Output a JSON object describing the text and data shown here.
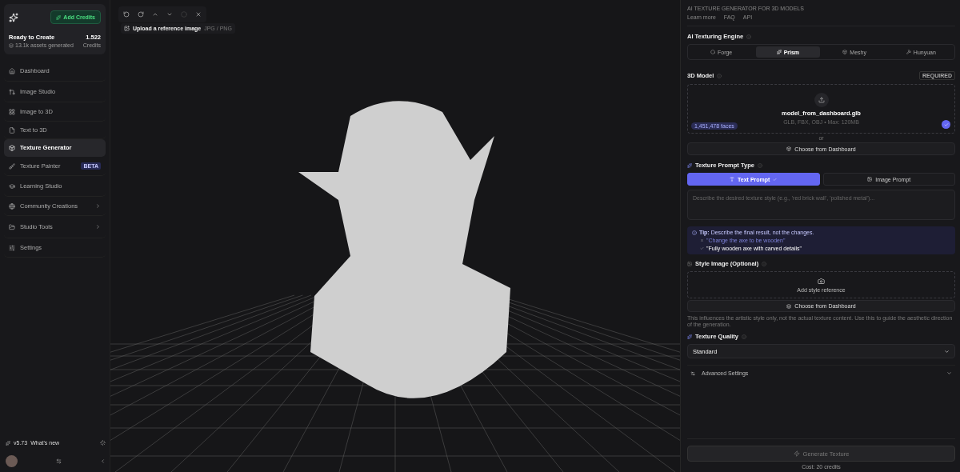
{
  "account": {
    "add_credits": "Add Credits",
    "status": "Ready to Create",
    "assets": "13.1k assets generated",
    "credits_value": "1.522",
    "credits_label": "Credits"
  },
  "sidebar": {
    "items": [
      {
        "label": "Dashboard",
        "selected": false,
        "submenu": false
      },
      {
        "label": "Image Studio",
        "selected": false,
        "submenu": false
      },
      {
        "label": "Image to 3D",
        "selected": false,
        "submenu": false
      },
      {
        "label": "Text to 3D",
        "selected": false,
        "submenu": false
      },
      {
        "label": "Texture Generator",
        "selected": true,
        "submenu": false
      },
      {
        "label": "Texture Painter",
        "selected": false,
        "submenu": false,
        "badge": "BETA"
      },
      {
        "label": "Learning Studio",
        "selected": false,
        "submenu": false
      },
      {
        "label": "Community Creations",
        "selected": false,
        "submenu": true
      },
      {
        "label": "Studio Tools",
        "selected": false,
        "submenu": true
      },
      {
        "label": "Settings",
        "selected": false,
        "submenu": false
      }
    ],
    "version": "v5.73",
    "whats_new": "What's new"
  },
  "viewport": {
    "tools": [
      {
        "disabled": false
      },
      {
        "disabled": false
      },
      {
        "disabled": false
      },
      {
        "disabled": false
      },
      {
        "disabled": true
      },
      {
        "disabled": false
      }
    ],
    "upload_label": "Upload a reference image",
    "upload_formats": "JPG / PNG"
  },
  "panel": {
    "eyebrow": "AI TEXTURE GENERATOR FOR 3D MODELS",
    "links": [
      "Learn more",
      "FAQ",
      "API"
    ],
    "engine_title": "AI Texturing Engine",
    "engines": [
      {
        "label": "Forge",
        "selected": false
      },
      {
        "label": "Prism",
        "selected": true
      },
      {
        "label": "Meshy",
        "selected": false
      },
      {
        "label": "Hunyuan",
        "selected": false
      }
    ],
    "model_title": "3D Model",
    "required": "REQUIRED",
    "file_name": "model_from_dashboard.glb",
    "formats": "GLB, FBX, OBJ • Max: 120MB",
    "faces": "1,451,478 faces",
    "uploaded": true,
    "or": "or",
    "choose_dashboard": "Choose from Dashboard",
    "prompt_type_title": "Texture Prompt Type",
    "prompt_types": [
      {
        "label": "Text Prompt",
        "selected": true
      },
      {
        "label": "Image Prompt",
        "selected": false
      }
    ],
    "prompt_placeholder": "Describe the desired texture style (e.g., 'red brick wall', 'polished metal')...",
    "tip": {
      "title": "Tip:",
      "text": "Describe the final result, not the changes.",
      "bad": "\"Change the axe to be wooden\"",
      "good": "\"Fully wooden axe with carved details\""
    },
    "style_title": "Style Image (Optional)",
    "add_style": "Add style reference",
    "choose_dashboard_2": "Choose from Dashboard",
    "style_note": "This influences the artistic style only, not the actual texture content. Use this to guide the aesthetic direction of the generation.",
    "quality_title": "Texture Quality",
    "quality_value": "Standard",
    "advanced": {
      "label": "Advanced Settings",
      "expanded": false
    },
    "generate": {
      "label": "Generate Texture",
      "disabled": true
    },
    "cost": "Cost: 20 credits"
  }
}
